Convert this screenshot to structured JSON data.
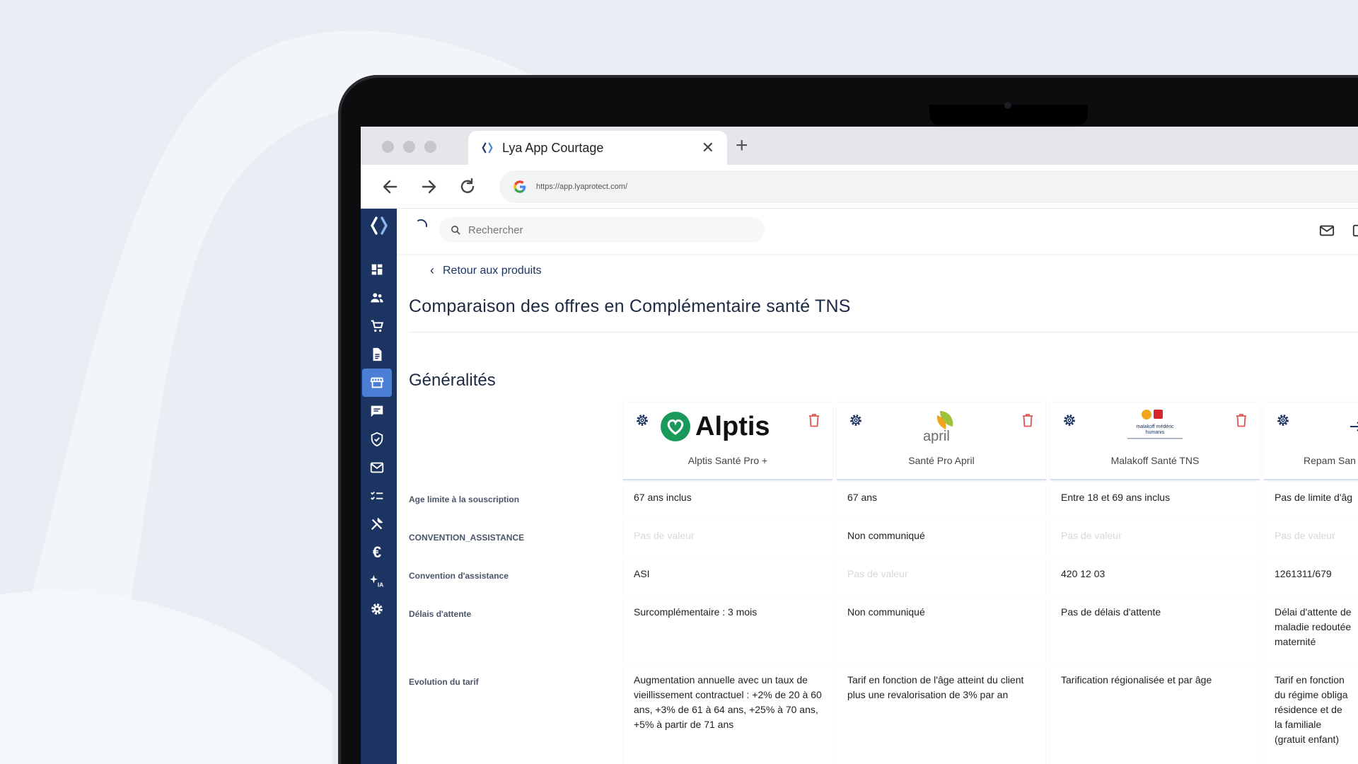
{
  "browser": {
    "tab_title": "Lya App Courtage",
    "url": "https://app.lyaprotect.com/"
  },
  "topbar": {
    "search_placeholder": "Rechercher"
  },
  "page": {
    "back_label": "Retour aux produits",
    "title": "Comparaison des offres en Complémentaire santé TNS",
    "section_title": "Généralités"
  },
  "icons": {
    "sidebar": [
      "dashboard-icon",
      "people-icon",
      "cart-icon",
      "document-icon",
      "store-icon",
      "chat-icon",
      "shield-check-icon",
      "mail-icon",
      "checklist-icon",
      "tools-icon",
      "euro-icon",
      "sparkle-ia-icon",
      "settings-icon"
    ],
    "sidebar_active": "store-icon"
  },
  "colors": {
    "sidebar": "#1c3461",
    "sidebar_active": "#4b7fd6",
    "delete": "#e05555"
  },
  "offers": [
    {
      "name": "Alptis Santé Pro +",
      "brand": "Alptis"
    },
    {
      "name": "Santé Pro April",
      "brand": "april"
    },
    {
      "name": "Malakoff Santé TNS",
      "brand": "malakoff médéric humanis"
    },
    {
      "name": "Repam San",
      "brand": ""
    }
  ],
  "rows": [
    {
      "label": "Age limite à la souscription",
      "values": [
        "67 ans inclus",
        "67 ans",
        "Entre 18 et 69 ans inclus",
        "Pas de limite d'âg"
      ]
    },
    {
      "label": "CONVENTION_ASSISTANCE",
      "values": [
        "Pas de valeur",
        "Non communiqué",
        "Pas de valeur",
        "Pas de valeur"
      ]
    },
    {
      "label": "Convention d'assistance",
      "values": [
        "ASI",
        "Pas de valeur",
        "420 12 03",
        "1261311/679"
      ]
    },
    {
      "label": "Délais d'attente",
      "values": [
        "Surcomplémentaire : 3 mois",
        "Non communiqué",
        "Pas de délais d'attente",
        "Délai d'attente de maladie redoutée maternité"
      ]
    },
    {
      "label": "Evolution du tarif",
      "values": [
        "Augmentation annuelle avec un taux de vieillissement contractuel : +2% de 20 à 60 ans, +3% de 61 à 64 ans, +25% à 70 ans, +5% à partir de 71 ans",
        "Tarif en fonction de l'âge atteint du client plus une revalorisation de 3% par an",
        "Tarification régionalisée et par âge",
        "Tarif en fonction du régime obliga résidence et de la familiale (gratuit enfant)"
      ]
    }
  ]
}
